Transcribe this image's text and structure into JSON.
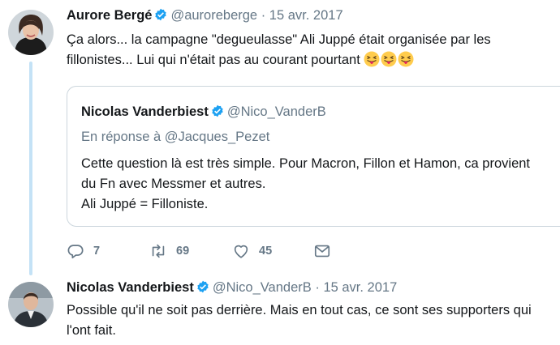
{
  "tweet1": {
    "author_name": "Aurore Bergé",
    "author_handle": "@auroreberge",
    "separator": "·",
    "date": "15 avr. 2017",
    "text_line1": "Ça alors... la campagne \"degueulasse\" Ali Juppé était organisée par les",
    "text_line2": "fillonistes... Lui qui n'était pas au courant pourtant",
    "emojis": [
      "squinting-tongue-emoji",
      "squinting-tongue-emoji",
      "squinting-tongue-emoji"
    ],
    "quote": {
      "author_name": "Nicolas Vanderbiest",
      "author_handle": "@Nico_VanderB",
      "reply_prefix": "En réponse à",
      "reply_to": "@Jacques_Pezet",
      "line1": "Cette question là est très simple. Pour Macron, Fillon et Hamon, ca provient",
      "line2": "du Fn avec Messmer et autres.",
      "line3": "Ali Juppé = Filloniste."
    },
    "actions": {
      "reply_count": "7",
      "retweet_count": "69",
      "like_count": "45"
    }
  },
  "tweet2": {
    "author_name": "Nicolas Vanderbiest",
    "author_handle": "@Nico_VanderB",
    "separator": "·",
    "date": "15 avr. 2017",
    "text_line1": "Possible qu'il ne soit pas derrière. Mais en tout cas, ce sont ses supporters qui",
    "text_line2": "l'ont fait."
  },
  "colors": {
    "verified": "#1da1f2",
    "thread_line": "#c4e2f6",
    "muted": "#657786",
    "border": "#ccd6dd"
  }
}
